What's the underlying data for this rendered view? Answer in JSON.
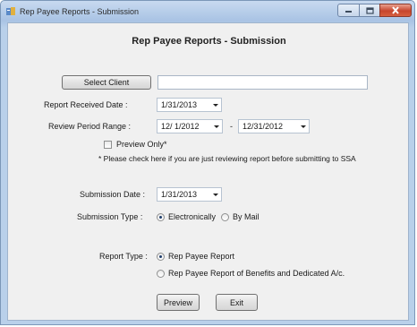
{
  "window": {
    "title": "Rep Payee Reports - Submission"
  },
  "form": {
    "heading": "Rep Payee Reports - Submission",
    "select_client_button": "Select Client",
    "client_value": "",
    "report_received_label": "Report Received Date :",
    "report_received_value": "1/31/2013",
    "review_period_label": "Review Period Range :",
    "review_period_start": "12/ 1/2012",
    "review_period_dash": "-",
    "review_period_end": "12/31/2012",
    "preview_only_label": "Preview Only*",
    "preview_only_checked": false,
    "preview_note": "* Please check here if you are just reviewing report before submitting to SSA",
    "submission_date_label": "Submission Date :",
    "submission_date_value": "1/31/2013",
    "submission_type_label": "Submission Type :",
    "submission_type_options": [
      "Electronically",
      "By Mail"
    ],
    "submission_type_selected": "Electronically",
    "report_type_label": "Report Type :",
    "report_type_options": [
      "Rep Payee Report",
      "Rep Payee Report of Benefits and Dedicated A/c."
    ],
    "report_type_selected": "Rep Payee Report",
    "preview_button": "Preview",
    "exit_button": "Exit"
  },
  "colors": {
    "titlebar": "#a9c3e4",
    "client_bg": "#f0f0f0",
    "close_button": "#c7452d"
  },
  "icons": [
    "app-icon",
    "minimize-icon",
    "maximize-icon",
    "close-icon",
    "dropdown-arrow-icon"
  ]
}
